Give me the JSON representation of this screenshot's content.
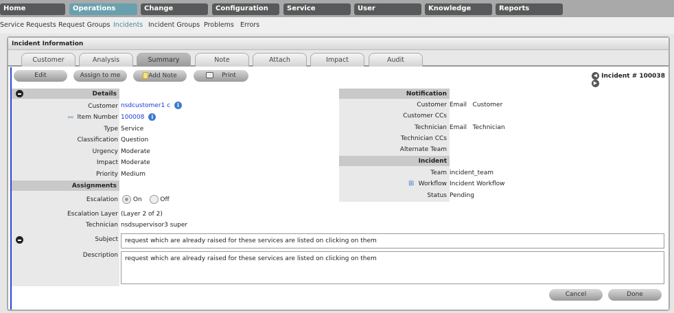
{
  "topnav": [
    "Home",
    "Operations",
    "Change",
    "Configuration",
    "Service",
    "User",
    "Knowledge",
    "Reports"
  ],
  "topnav_selected": "Operations",
  "subnav": [
    "Service Requests",
    "Request Groups",
    "Incidents",
    "Incident Groups",
    "Problems",
    "Errors"
  ],
  "subnav_selected": "Incidents",
  "panel_title": "Incident Information",
  "tabs": [
    "Customer",
    "Analysis",
    "Summary",
    "Note",
    "Attach",
    "Impact",
    "Audit"
  ],
  "tab_selected": "Summary",
  "toolbar": {
    "edit": "Edit",
    "assign": "Assign to me",
    "add_note": "Add Note",
    "print": "Print"
  },
  "incident_nav": "Incident # 100038",
  "details": {
    "header": "Details",
    "customer_label": "Customer",
    "customer": "nsdcustomer1 c",
    "item_label": "Item Number",
    "item": "100008",
    "rows": [
      {
        "label": "Type",
        "value": "Service"
      },
      {
        "label": "Classification",
        "value": "Question"
      },
      {
        "label": "Urgency",
        "value": "Moderate"
      },
      {
        "label": "Impact",
        "value": "Moderate"
      },
      {
        "label": "Priority",
        "value": "Medium"
      }
    ]
  },
  "assignments": {
    "header": "Assignments",
    "escalation_label": "Escalation",
    "on": "On",
    "off": "Off",
    "escalation_value": "On",
    "layer_label": "Escalation Layer",
    "layer": "(Layer 2 of 2)",
    "tech_label": "Technician",
    "tech": "nsdsupervisor3 super"
  },
  "notification": {
    "header": "Notification",
    "rows": [
      {
        "label": "Customer",
        "value": "Email   Customer"
      },
      {
        "label": "Customer CCs",
        "value": ""
      },
      {
        "label": "Technician",
        "value": "Email   Technician"
      },
      {
        "label": "Technician CCs",
        "value": ""
      },
      {
        "label": "Alternate Team",
        "value": ""
      }
    ]
  },
  "incident": {
    "header": "Incident",
    "team_label": "Team",
    "team": "incident_team",
    "workflow_label": "Workflow",
    "workflow": "Incident Workflow",
    "status_label": "Status",
    "status": "Pending"
  },
  "subject_label": "Subject",
  "subject": "request which are already raised for these services are listed on clicking on them",
  "description_label": "Description",
  "description": "request which are already raised for these services are listed on clicking on them",
  "footer": {
    "cancel": "Cancel",
    "done": "Done"
  },
  "colors": {
    "selected_nav": "#6aa0ae",
    "nav": "#575a5a",
    "link": "#1a3bd0",
    "content_border": "#2747d8"
  }
}
